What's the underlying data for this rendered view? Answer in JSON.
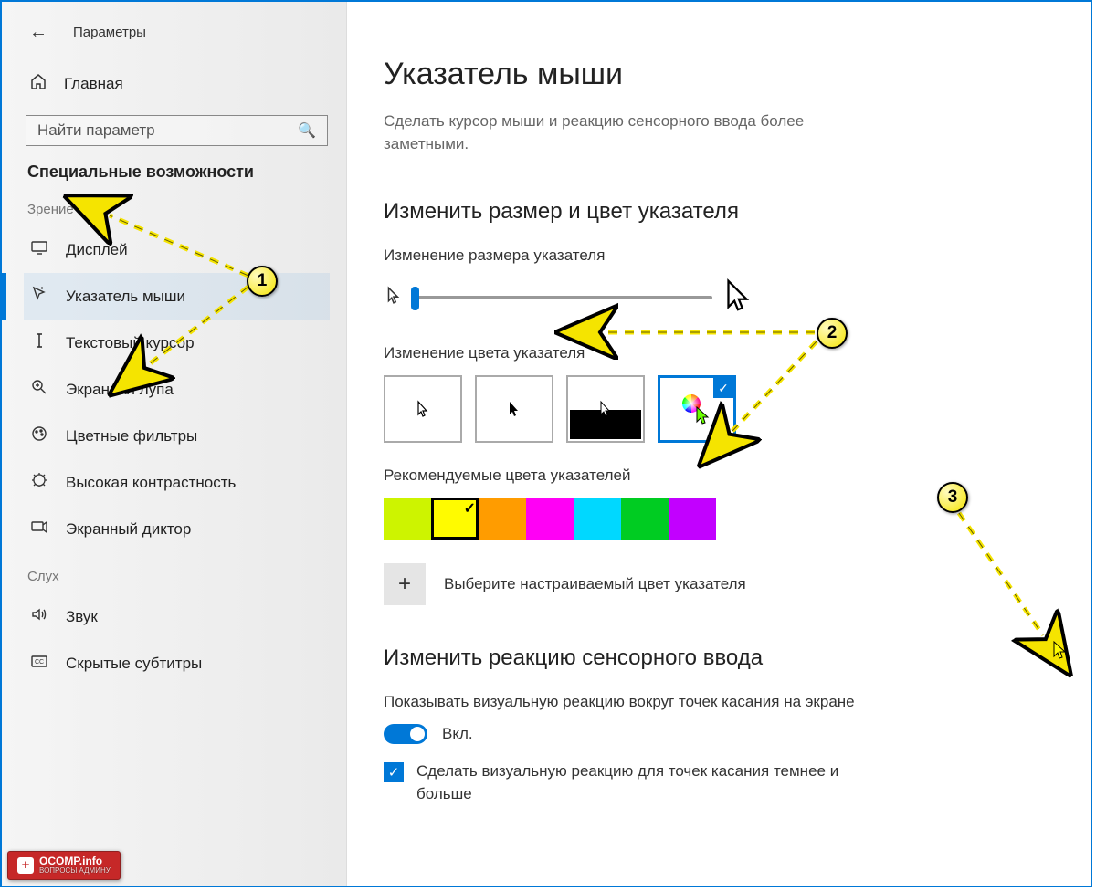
{
  "header": {
    "app_title": "Параметры"
  },
  "sidebar": {
    "home": "Главная",
    "search_placeholder": "Найти параметр",
    "section": "Специальные возможности",
    "group_vision": "Зрение",
    "group_hearing": "Слух",
    "items_vision": [
      {
        "label": "Дисплей"
      },
      {
        "label": "Указатель мыши"
      },
      {
        "label": "Текстовый курсор"
      },
      {
        "label": "Экранная лупа"
      },
      {
        "label": "Цветные фильтры"
      },
      {
        "label": "Высокая контрастность"
      },
      {
        "label": "Экранный диктор"
      }
    ],
    "items_hearing": [
      {
        "label": "Звук"
      },
      {
        "label": "Скрытые субтитры"
      }
    ]
  },
  "main": {
    "title": "Указатель мыши",
    "subtitle": "Сделать курсор мыши и реакцию сенсорного ввода более заметными.",
    "h2_size_color": "Изменить размер и цвет указателя",
    "lbl_size": "Изменение размера указателя",
    "lbl_color": "Изменение цвета указателя",
    "lbl_recommended": "Рекомендуемые цвета указателей",
    "custom_color": "Выберите настраиваемый цвет указателя",
    "h2_touch": "Изменить реакцию сенсорного ввода",
    "touch_desc": "Показывать визуальную реакцию вокруг точек касания на экране",
    "toggle_on": "Вкл.",
    "chk_label": "Сделать визуальную реакцию для точек касания темнее и больше",
    "recommended_colors": [
      "#cdf400",
      "#fffb00",
      "#ff9c00",
      "#ff00f5",
      "#00d8ff",
      "#00cc22",
      "#c200ff"
    ],
    "selected_swatch_index": 1,
    "selected_color_option": 3,
    "cursor_size_value": 1
  },
  "annotations": {
    "badges": [
      "1",
      "2",
      "3"
    ],
    "watermark_main": "OCOMP.info",
    "watermark_sub": "ВОПРОСЫ АДМИНУ"
  }
}
